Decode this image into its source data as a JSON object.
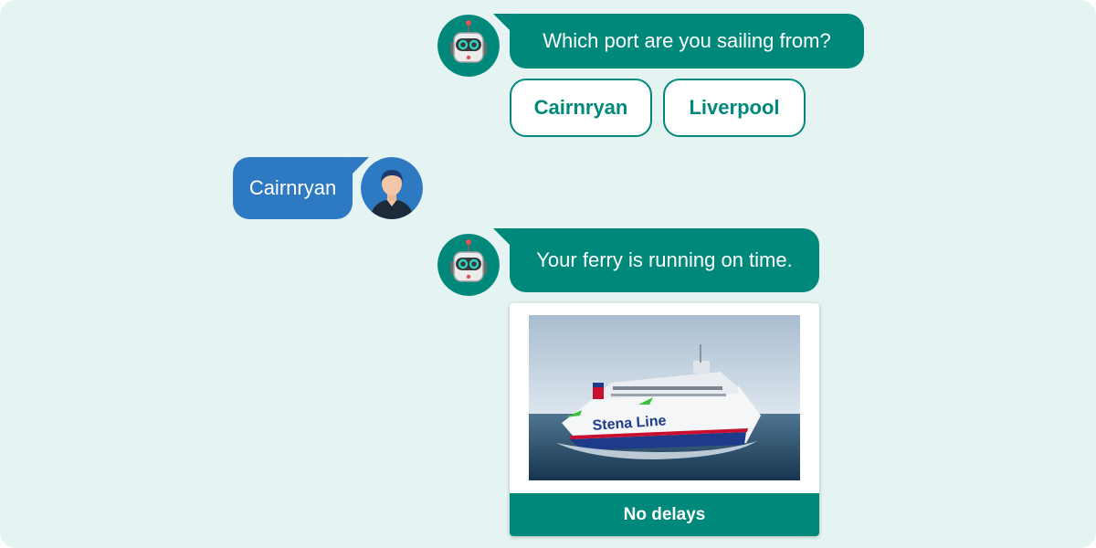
{
  "colors": {
    "background": "#e5f3f2",
    "bot_accent": "#00897b",
    "user_accent": "#2d79c2"
  },
  "icons": {
    "bot_avatar": "robot-icon",
    "user_avatar": "person-icon",
    "ship_image": "ferry-photo"
  },
  "messages": [
    {
      "sender": "bot",
      "text": "Which port are you sailing from?"
    },
    {
      "sender": "user",
      "text": "Cairnryan"
    },
    {
      "sender": "bot",
      "text": "Your ferry is running on time."
    }
  ],
  "quick_replies": [
    {
      "label": "Cairnryan"
    },
    {
      "label": "Liverpool"
    }
  ],
  "status_card": {
    "ship_livery": "Stena Line",
    "footer_label": "No delays"
  }
}
